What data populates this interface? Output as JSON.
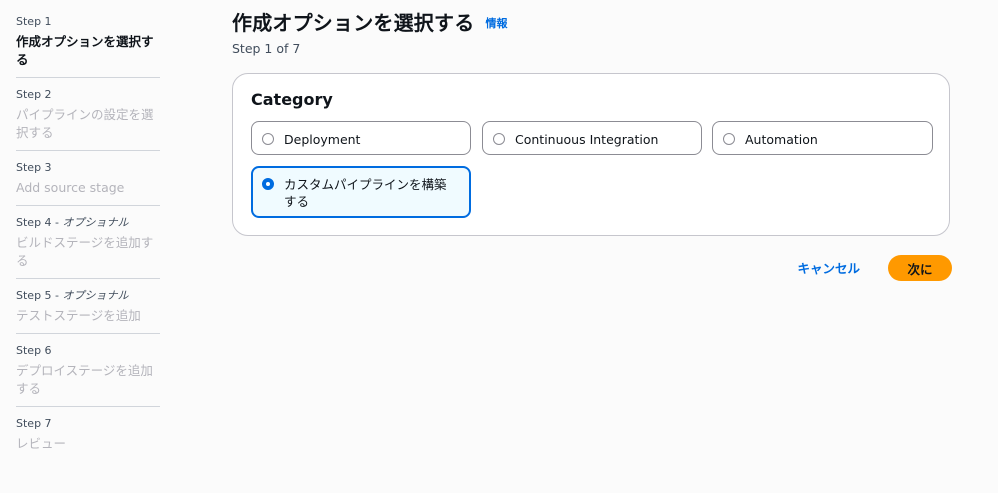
{
  "steps": [
    {
      "label": "Step 1",
      "optional": "",
      "title": "作成オプションを選択する",
      "active": true
    },
    {
      "label": "Step 2",
      "optional": "",
      "title": "パイプラインの設定を選択する",
      "active": false
    },
    {
      "label": "Step 3",
      "optional": "",
      "title": "Add source stage",
      "active": false
    },
    {
      "label": "Step 4 - ",
      "optional": "オプショナル",
      "title": "ビルドステージを追加する",
      "active": false
    },
    {
      "label": "Step 5 - ",
      "optional": "オプショナル",
      "title": "テストステージを追加",
      "active": false
    },
    {
      "label": "Step 6",
      "optional": "",
      "title": "デプロイステージを追加する",
      "active": false
    },
    {
      "label": "Step 7",
      "optional": "",
      "title": "レビュー",
      "active": false
    }
  ],
  "header": {
    "title": "作成オプションを選択する",
    "info_link": "情報",
    "step_counter": "Step 1 of 7"
  },
  "category": {
    "heading": "Category",
    "options": {
      "deployment": "Deployment",
      "continuous_integration": "Continuous Integration",
      "automation": "Automation",
      "custom_pipeline": "カスタムパイプラインを構築する"
    },
    "selected": "custom_pipeline"
  },
  "actions": {
    "cancel_label": "キャンセル",
    "next_label": "次に"
  },
  "colors": {
    "accent": "#006ce0",
    "primary_button": "#ff9900",
    "selected_tile_bg": "#f0fbff"
  }
}
